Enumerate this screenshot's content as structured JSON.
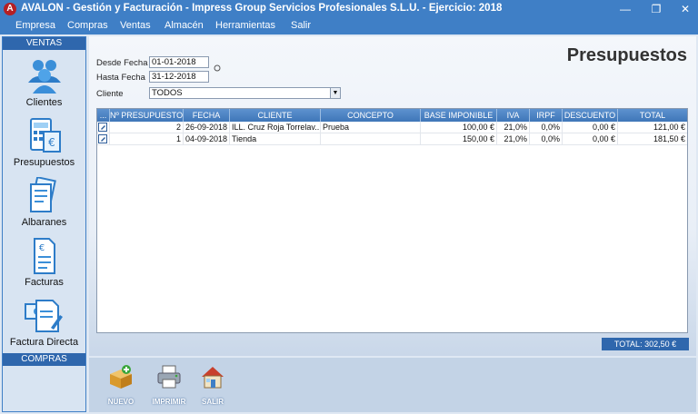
{
  "app": {
    "title": "AVALON - Gestión y Facturación - Impress Group Servicios Profesionales S.L.U. - Ejercicio: 2018",
    "logo_letter": "A"
  },
  "window_controls": {
    "minimize": "—",
    "maximize": "❐",
    "close": "✕"
  },
  "menu": [
    "Empresa",
    "Compras",
    "Ventas",
    "Almacén",
    "Herramientas",
    "Salir"
  ],
  "sidebar": {
    "section_ventas": "VENTAS",
    "section_compras": "COMPRAS",
    "items": [
      {
        "label": "Clientes",
        "icon": "clients-icon"
      },
      {
        "label": "Presupuestos",
        "icon": "budget-calculator-icon"
      },
      {
        "label": "Albaranes",
        "icon": "delivery-notes-icon"
      },
      {
        "label": "Facturas",
        "icon": "invoice-icon"
      },
      {
        "label": "Factura Directa",
        "icon": "direct-invoice-icon"
      }
    ]
  },
  "page_title": "Presupuestos",
  "filters": {
    "desde_label": "Desde Fecha",
    "desde_value": "01-01-2018",
    "hasta_label": "Hasta Fecha",
    "hasta_value": "31-12-2018",
    "cliente_label": "Cliente",
    "cliente_value": "TODOS"
  },
  "grid": {
    "columns": [
      "...",
      "Nº PRESUPUESTO",
      "FECHA",
      "CLIENTE",
      "CONCEPTO",
      "BASE IMPONIBLE",
      "IVA",
      "IRPF",
      "DESCUENTO",
      "TOTAL"
    ],
    "rows": [
      [
        "",
        "2",
        "26-09-2018",
        "ILL. Cruz Roja Torrelav...",
        "Prueba",
        "100,00 €",
        "21,0%",
        "0,0%",
        "0,00 €",
        "121,00 €"
      ],
      [
        "",
        "1",
        "04-09-2018",
        "Tienda",
        "",
        "150,00 €",
        "21,0%",
        "0,0%",
        "0,00 €",
        "181,50 €"
      ]
    ]
  },
  "total": "TOTAL:   302,50 €",
  "toolbar": [
    {
      "label": "NUEVO",
      "icon": "new-box-icon"
    },
    {
      "label": "IMPRIMIR",
      "icon": "printer-icon"
    },
    {
      "label": "SALIR",
      "icon": "exit-house-icon"
    }
  ],
  "colors": {
    "accent": "#3f7fc6",
    "header": "#2f67ad",
    "background": "#dfe8f3"
  }
}
